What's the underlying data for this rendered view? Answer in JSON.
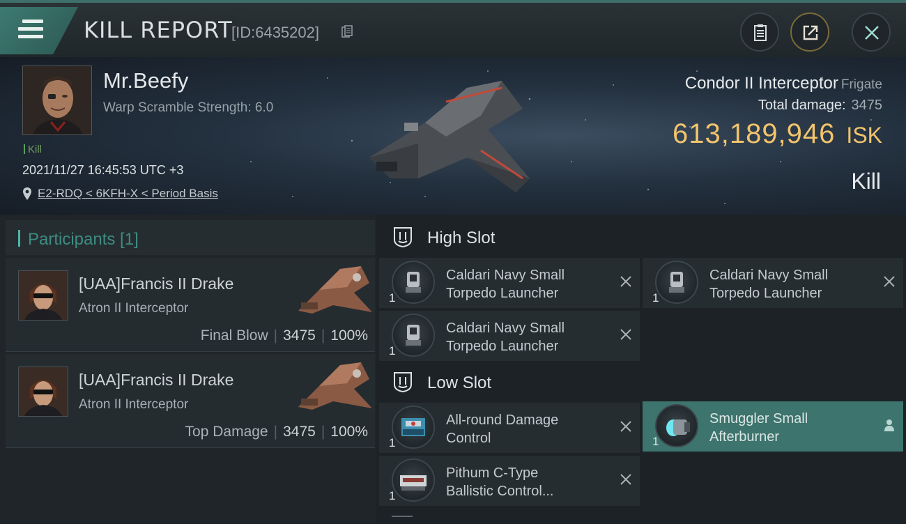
{
  "header": {
    "title": "KILL REPORT",
    "report_id": "[ID:6435202]"
  },
  "victim": {
    "pilot_name": "Mr.Beefy",
    "warp_scramble": "Warp Scramble Strength: 6.0",
    "tag": "Kill",
    "datetime": "2021/11/27 16:45:53 UTC +3",
    "location": "E2-RDQ < 6KFH-X < Period Basis",
    "ship_name": "Condor II Interceptor",
    "ship_class": "Frigate",
    "total_damage_label": "Total damage:",
    "total_damage": "3475",
    "isk_value": "613,189,946",
    "isk_unit": "ISK",
    "result": "Kill"
  },
  "participants": {
    "heading": "Participants [1]",
    "items": [
      {
        "name": "[UAA]Francis II Drake",
        "ship": "Atron II Interceptor",
        "role": "Final Blow",
        "damage": "3475",
        "percent": "100%"
      },
      {
        "name": "[UAA]Francis II Drake",
        "ship": "Atron II Interceptor",
        "role": "Top Damage",
        "damage": "3475",
        "percent": "100%"
      }
    ]
  },
  "fittings": {
    "high_slot": {
      "label": "High Slot",
      "modules": [
        {
          "qty": "1",
          "line1": "Caldari Navy Small",
          "line2": "Torpedo Launcher"
        },
        {
          "qty": "1",
          "line1": "Caldari Navy Small",
          "line2": "Torpedo Launcher"
        },
        {
          "qty": "1",
          "line1": "Caldari Navy Small",
          "line2": "Torpedo Launcher"
        }
      ]
    },
    "low_slot": {
      "label": "Low Slot",
      "modules": [
        {
          "qty": "1",
          "line1": "All-round Damage",
          "line2": "Control"
        },
        {
          "qty": "1",
          "line1": "Smuggler Small",
          "line2": "Afterburner"
        },
        {
          "qty": "1",
          "line1": "Pithum C-Type",
          "line2": "Ballistic Control..."
        }
      ]
    }
  },
  "colors": {
    "accent": "#3d746d",
    "isk": "#f2c46c",
    "participants_heading": "#3f8c82"
  }
}
